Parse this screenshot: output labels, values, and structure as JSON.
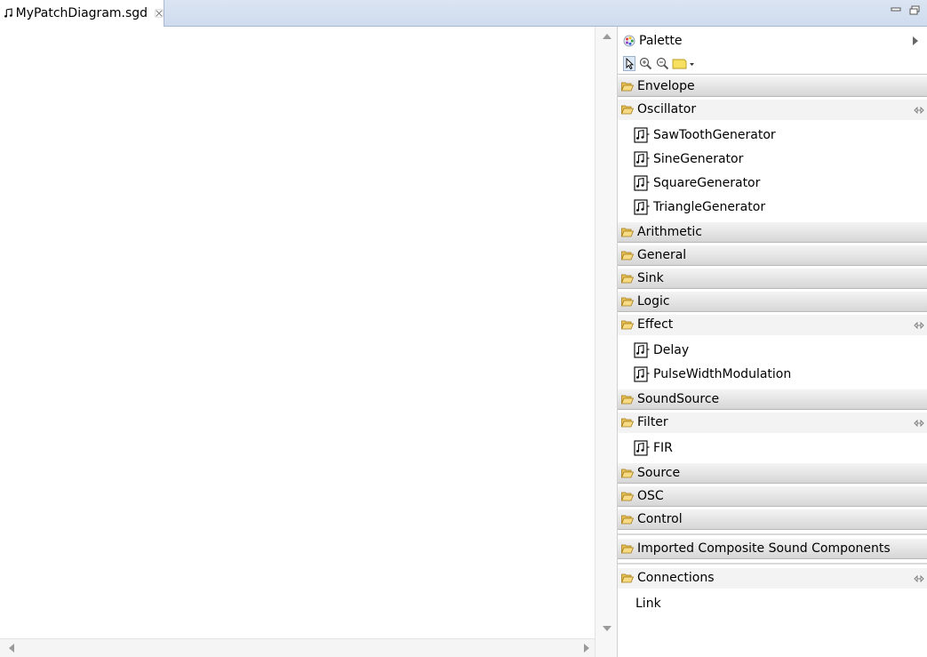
{
  "editor": {
    "tab_label": "MyPatchDiagram.sgd"
  },
  "palette": {
    "title": "Palette",
    "drawers": [
      {
        "label": "Envelope",
        "open": false
      },
      {
        "label": "Oscillator",
        "open": true,
        "items": [
          "SawToothGenerator",
          "SineGenerator",
          "SquareGenerator",
          "TriangleGenerator"
        ]
      },
      {
        "label": "Arithmetic",
        "open": false
      },
      {
        "label": "General",
        "open": false
      },
      {
        "label": "Sink",
        "open": false
      },
      {
        "label": "Logic",
        "open": false
      },
      {
        "label": "Effect",
        "open": true,
        "items": [
          "Delay",
          "PulseWidthModulation"
        ]
      },
      {
        "label": "SoundSource",
        "open": false
      },
      {
        "label": "Filter",
        "open": true,
        "items": [
          "FIR"
        ]
      },
      {
        "label": "Source",
        "open": false
      },
      {
        "label": "OSC",
        "open": false
      },
      {
        "label": "Control",
        "open": false
      },
      {
        "label": "Imported Composite Sound Components",
        "open": false
      },
      {
        "label": "Connections",
        "open": true,
        "items": [
          "Link"
        ]
      }
    ]
  },
  "icons": {
    "tab": "music-note-icon",
    "palette": "palette-icon",
    "drawer": "folder-open-icon",
    "component": "sound-component-icon",
    "pin": "pin-icon"
  }
}
